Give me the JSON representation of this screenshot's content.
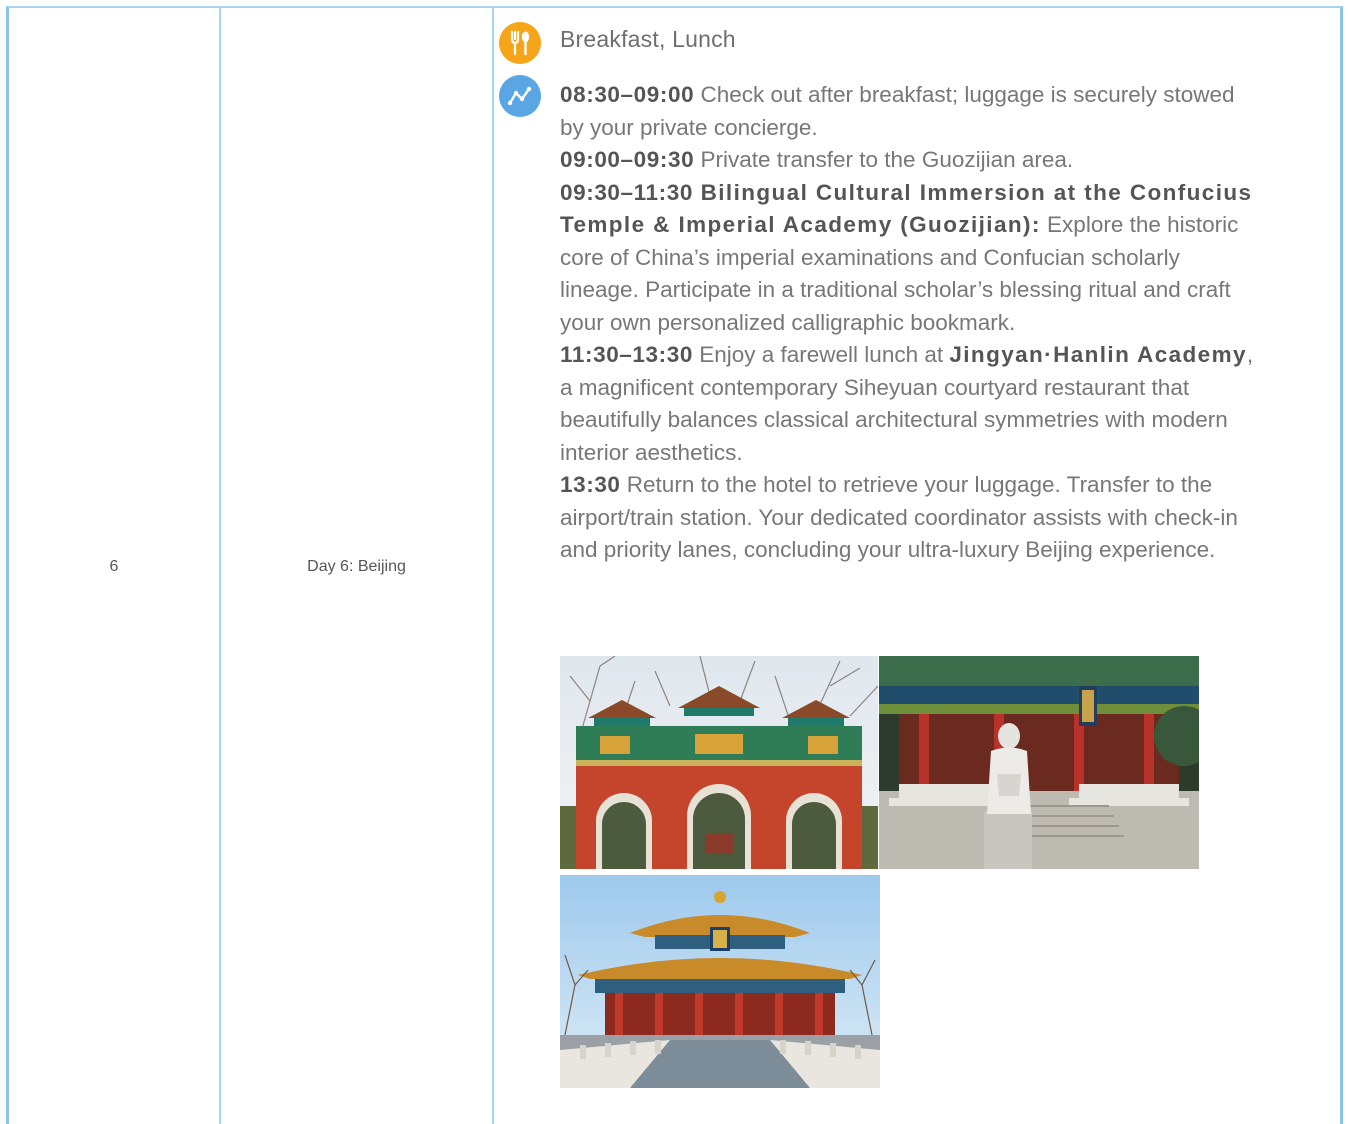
{
  "row": {
    "day_number": "6",
    "day_title": "Day 6: Beijing"
  },
  "icons": {
    "meal": "fork-knife-icon",
    "route": "route-icon",
    "meal_color": "#f6a51b",
    "route_color": "#5aa5e4"
  },
  "meals": "Breakfast, Lunch",
  "itinerary": [
    {
      "time": "08:30–09:00",
      "bold": "",
      "text": " Check out after breakfast; luggage is securely stowed by your private concierge."
    },
    {
      "time": "09:00–09:30",
      "bold": "",
      "text": " Private transfer to the Guozijian area."
    },
    {
      "time": "09:30–11:30",
      "bold": " Bilingual Cultural Immersion at the Confucius Temple & Imperial Academy (Guozijian):",
      "text": " Explore the historic core of China’s imperial examinations and Confucian scholarly lineage. Participate in a traditional scholar’s blessing ritual and craft your own personalized calligraphic bookmark."
    },
    {
      "time": "11:30–13:30",
      "text_before": " Enjoy a farewell lunch at ",
      "bold": "Jingyan·Hanlin Academy",
      "text": ", a magnificent contemporary Siheyuan courtyard restaurant that beautifully balances classical architectural symmetries with modern interior aesthetics."
    },
    {
      "time": "13:30",
      "bold": "",
      "text": " Return to the hotel to retrieve your luggage. Transfer to the airport/train station. Your dedicated coordinator assists with check-in and priority lanes, concluding your ultra-luxury Beijing experience."
    }
  ],
  "photos": [
    {
      "name": "imperial-academy-archway-photo"
    },
    {
      "name": "confucius-statue-temple-photo"
    },
    {
      "name": "biyong-hall-photo"
    }
  ]
}
